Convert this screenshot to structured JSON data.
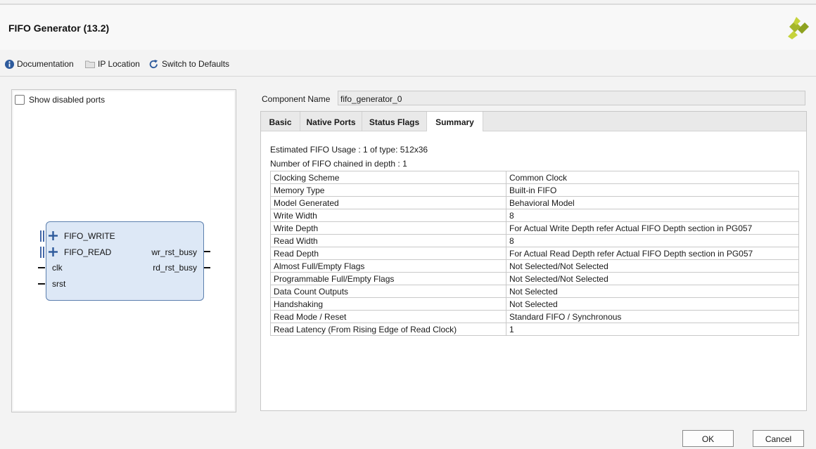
{
  "window": {
    "title": "FIFO Generator (13.2)"
  },
  "toolbar": {
    "documentation_label": "Documentation",
    "ip_location_label": "IP Location",
    "switch_defaults_label": "Switch to Defaults"
  },
  "left_panel": {
    "show_disabled_ports_label": "Show disabled ports",
    "show_disabled_ports_checked": false,
    "block": {
      "bus_ports": [
        "FIFO_WRITE",
        "FIFO_READ"
      ],
      "left_ports": [
        "clk",
        "srst"
      ],
      "right_ports": [
        "wr_rst_busy",
        "rd_rst_busy"
      ]
    }
  },
  "component": {
    "label": "Component Name",
    "value": "fifo_generator_0"
  },
  "tabs": [
    {
      "label": "Basic",
      "active": false
    },
    {
      "label": "Native Ports",
      "active": false
    },
    {
      "label": "Status Flags",
      "active": false
    },
    {
      "label": "Summary",
      "active": true
    }
  ],
  "summary": {
    "usage_line": "Estimated FIFO Usage : 1 of type: 512x36",
    "chained_line": "Number of FIFO chained in depth : 1",
    "rows": [
      [
        "Clocking Scheme",
        "Common Clock"
      ],
      [
        "Memory Type",
        "Built-in FIFO"
      ],
      [
        "Model Generated",
        "Behavioral Model"
      ],
      [
        "Write Width",
        "8"
      ],
      [
        "Write Depth",
        "For Actual Write Depth refer Actual FIFO Depth section in PG057"
      ],
      [
        "Read Width",
        "8"
      ],
      [
        "Read Depth",
        "For Actual Read Depth refer Actual FIFO Depth section in PG057"
      ],
      [
        "Almost Full/Empty Flags",
        "Not Selected/Not Selected"
      ],
      [
        "Programmable Full/Empty Flags",
        "Not Selected/Not Selected"
      ],
      [
        "Data Count Outputs",
        "Not Selected"
      ],
      [
        "Handshaking",
        "Not Selected"
      ],
      [
        "Read Mode / Reset",
        "Standard FIFO / Synchronous"
      ],
      [
        "Read Latency (From Rising Edge of Read Clock)",
        "1"
      ]
    ]
  },
  "buttons": {
    "ok_label": "OK",
    "cancel_label": "Cancel"
  },
  "colors": {
    "block_fill": "#dde8f6",
    "block_border": "#5c7fae",
    "logo": "#a5b62a",
    "info_icon": "#2d5a9c"
  }
}
